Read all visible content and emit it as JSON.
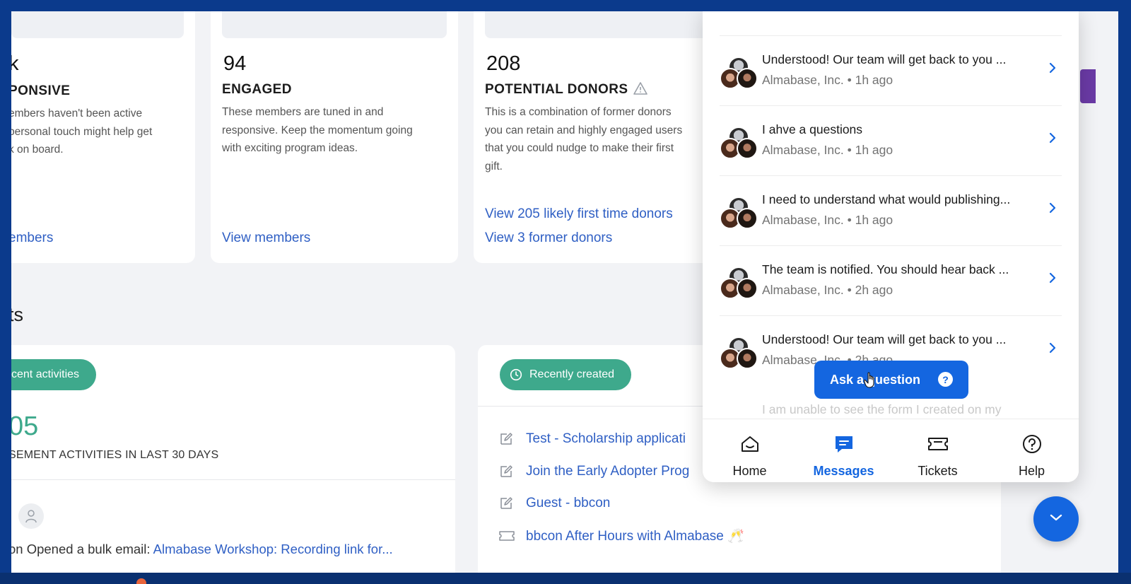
{
  "segments": [
    {
      "count": "k",
      "title": "PONSIVE",
      "desc": [
        "embers haven't been active",
        "personal touch might help get",
        "k on board."
      ],
      "links": [
        "embers"
      ]
    },
    {
      "count": "94",
      "title": "ENGAGED",
      "desc": [
        "These members are tuned in and",
        "responsive. Keep the momentum going",
        "with exciting program ideas."
      ],
      "links": [
        "View members"
      ]
    },
    {
      "count": "208",
      "title": "POTENTIAL DONORS",
      "desc": [
        "This is a combination of former donors",
        "you can retain and highly engaged users",
        "that you could nudge to make their first",
        "gift."
      ],
      "links": [
        "View 205 likely first time donors",
        "View 3 former donors"
      ]
    }
  ],
  "section_title": "ts",
  "activities": {
    "pill_label": "cent activities",
    "count": "05",
    "caption": "SEMENT ACTIVITIES IN LAST 30 DAYS",
    "row_prefix": "on Opened a bulk email: ",
    "row_link": "Almabase Workshop: Recording link for..."
  },
  "recent": {
    "pill_label": "Recently created",
    "items": [
      {
        "icon": "edit-icon",
        "label": "Test - Scholarship applicati"
      },
      {
        "icon": "edit-icon",
        "label": "Join the Early Adopter Prog"
      },
      {
        "icon": "edit-icon",
        "label": "Guest - bbcon"
      },
      {
        "icon": "ticket-icon",
        "label": "bbcon After Hours with Almabase 🥂"
      }
    ]
  },
  "chat": {
    "messages": [
      {
        "text": "Understood! Our team will get back to you ...",
        "meta": "Almabase, Inc. • 1h ago"
      },
      {
        "text": "I ahve a questions",
        "meta": "Almabase, Inc. • 1h ago"
      },
      {
        "text": "I need to understand what would publishing...",
        "meta": "Almabase, Inc. • 1h ago"
      },
      {
        "text": "The team is notified. You should hear back ...",
        "meta": "Almabase, Inc. • 2h ago"
      },
      {
        "text": "Understood! Our team will get back to you ...",
        "meta": "Almabase, Inc. • 2h ago"
      }
    ],
    "faded_text": "I am unable to see the form I created on my",
    "ask_button": "Ask a question",
    "tabs": [
      {
        "label": "Home",
        "icon": "home-icon"
      },
      {
        "label": "Messages",
        "icon": "messages-icon"
      },
      {
        "label": "Tickets",
        "icon": "tickets-icon"
      },
      {
        "label": "Help",
        "icon": "help-icon"
      }
    ],
    "active_tab": "Messages"
  },
  "colors": {
    "accent": "#1466e0",
    "link": "#2f5fc4",
    "green": "#3ea98c",
    "frame": "#0b3a8c"
  }
}
